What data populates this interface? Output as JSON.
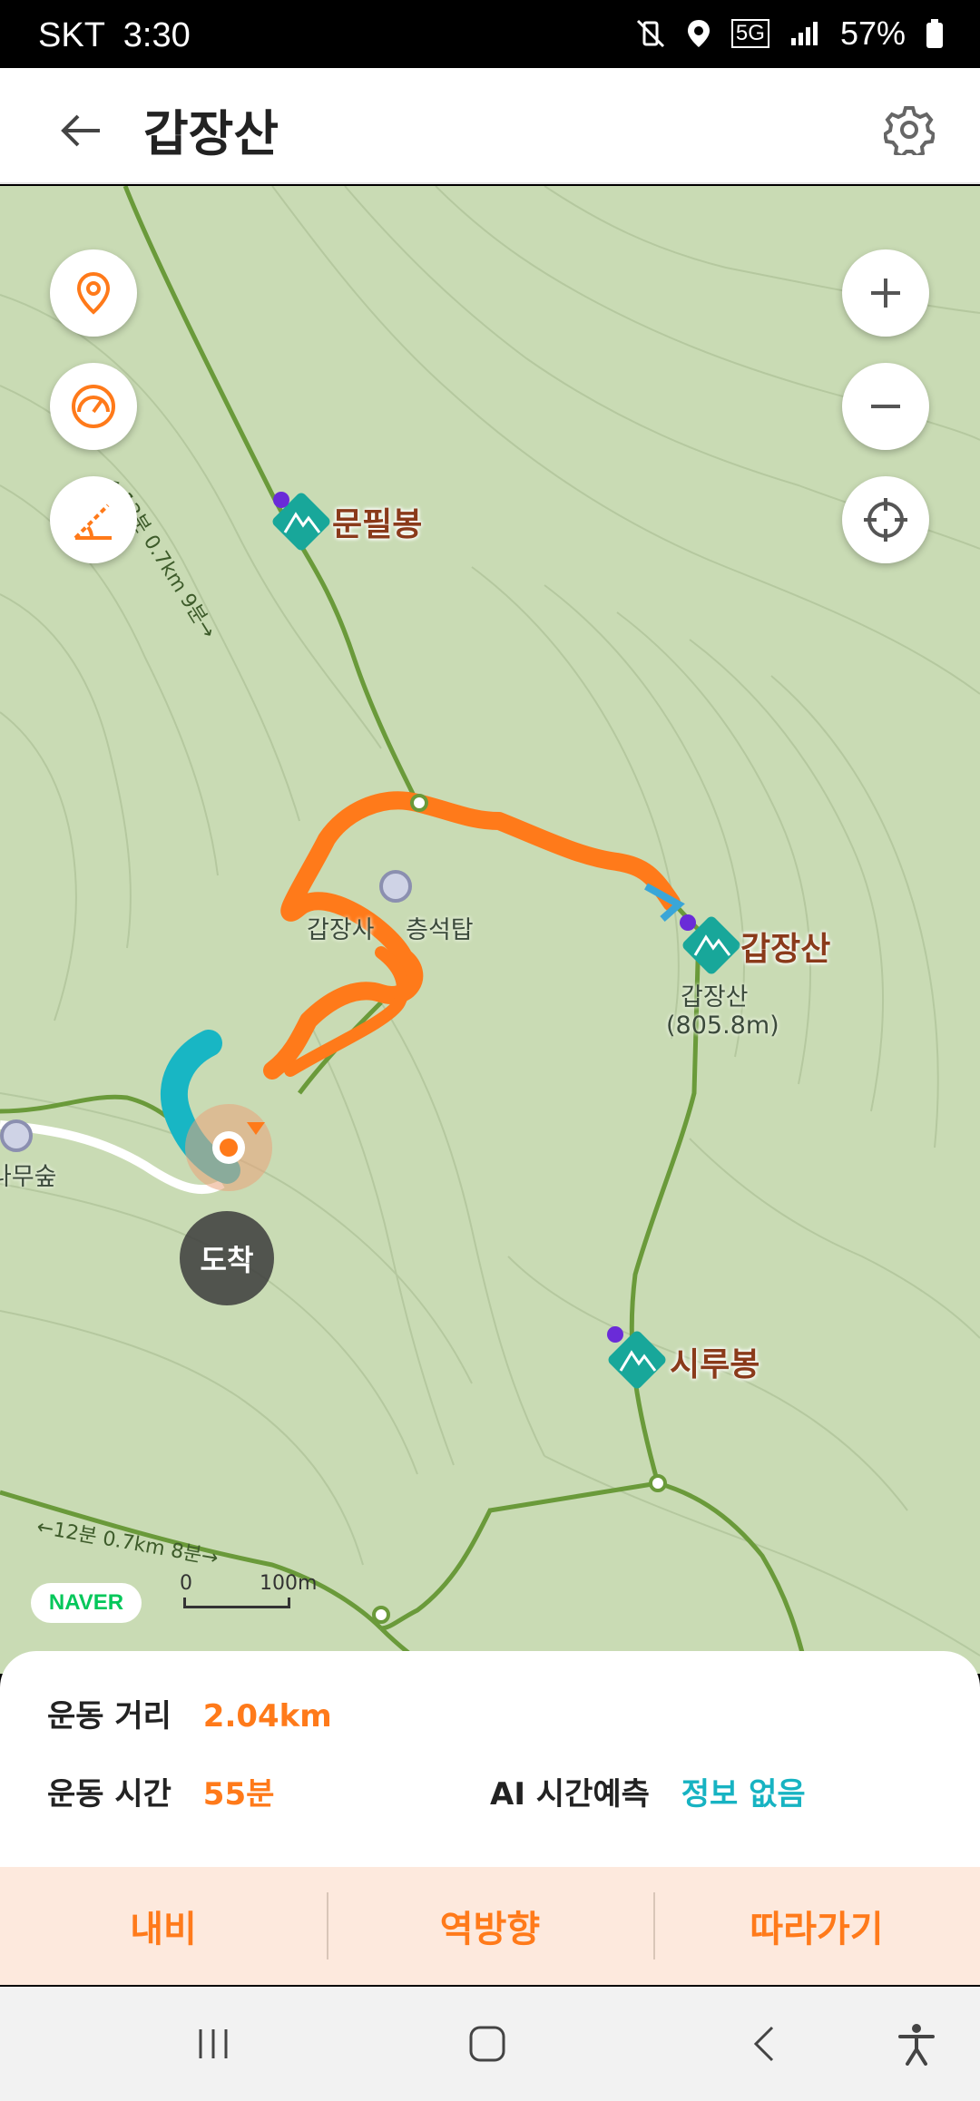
{
  "status_bar": {
    "carrier": "SKT",
    "time": "3:30",
    "network": "5G",
    "battery": "57%"
  },
  "app_bar": {
    "title": "갑장산",
    "back_icon": "arrow-left-icon",
    "settings_icon": "gear-icon"
  },
  "map": {
    "left_controls": [
      "location-pin-icon",
      "speedometer-icon",
      "slope-icon"
    ],
    "right_controls": [
      "zoom-in-icon",
      "zoom-out-icon",
      "crosshair-icon"
    ],
    "peaks": [
      {
        "name": "문필봉"
      },
      {
        "name": "갑장산"
      },
      {
        "name": "시루봉"
      }
    ],
    "summit_label": "갑장산",
    "summit_elevation": "(805.8m)",
    "poi_pagoda": "갑장사",
    "poi_pagoda_suffix": "층석탑",
    "poi_forest": "나무숲",
    "trail_label_top": "←13분 0.7km 9분→",
    "trail_label_bottom": "←12분 0.7km 8분→",
    "arrival_label": "도착",
    "naver_logo": "NAVER",
    "scale_zero": "0",
    "scale_distance": "100m",
    "colors": {
      "track": "#ff7a1a",
      "trail": "#6a9a3a",
      "terrain": "#c9dbb4"
    }
  },
  "info": {
    "distance_label": "운동 거리",
    "distance_value": "2.04km",
    "time_label": "운동 시간",
    "time_value": "55분",
    "ai_label": "AI 시간예측",
    "ai_value": "정보 없음"
  },
  "actions": [
    "내비",
    "역방향",
    "따라가기"
  ],
  "nav": [
    "recent-apps-icon",
    "home-icon",
    "back-icon",
    "accessibility-icon"
  ]
}
